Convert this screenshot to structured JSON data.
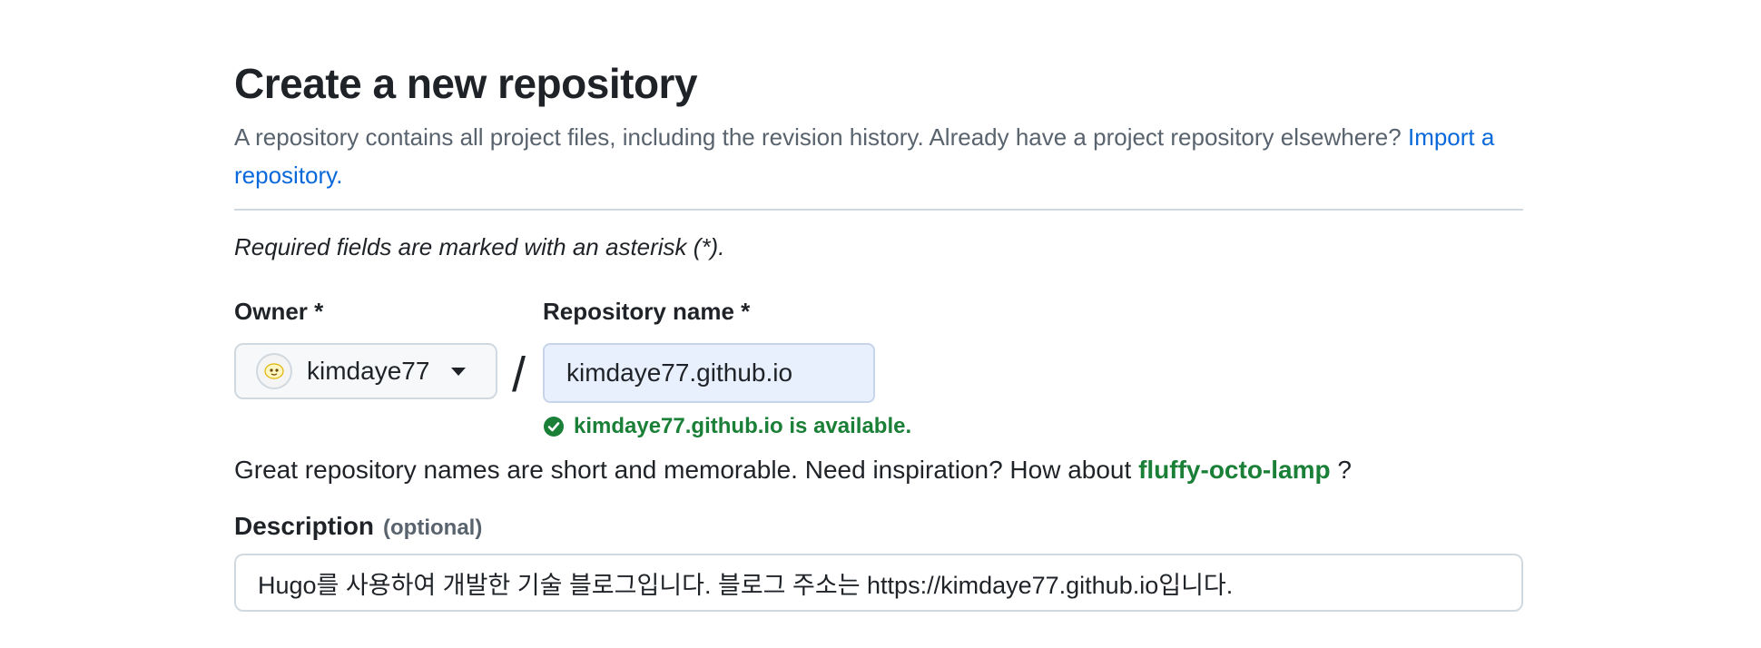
{
  "header": {
    "title": "Create a new repository",
    "subtitle_text": "A repository contains all project files, including the revision history. Already have a project repository elsewhere?",
    "import_link": "Import a repository."
  },
  "form": {
    "required_note": "Required fields are marked with an asterisk (*).",
    "owner": {
      "label": "Owner *",
      "value": "kimdaye77",
      "avatar_icon": "avatar-icon"
    },
    "separator": "/",
    "repository_name": {
      "label": "Repository name *",
      "value": "kimdaye77.github.io",
      "availability": "kimdaye77.github.io is available.",
      "availability_color": "#1a7f37"
    },
    "suggestion": {
      "prefix": "Great repository names are short and memorable. Need inspiration? How about",
      "name": "fluffy-octo-lamp",
      "suffix": "?"
    },
    "description": {
      "label": "Description",
      "optional": "(optional)",
      "value": "Hugo를 사용하여 개발한 기술 블로그입니다. 블로그 주소는 https://kimdaye77.github.io입니다."
    }
  },
  "colors": {
    "link": "#0969da",
    "success": "#1a7f37",
    "muted": "#59636e",
    "border": "#d1d9e0"
  }
}
